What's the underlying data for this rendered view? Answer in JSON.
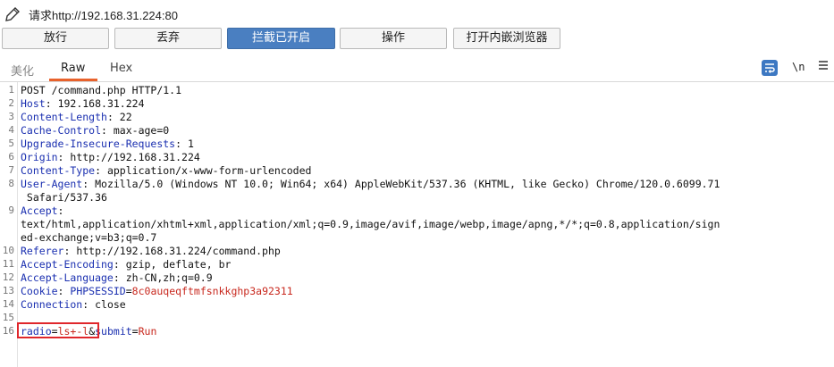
{
  "titlebar": {
    "icon": "pencil-icon",
    "title": "请求http://192.168.31.224:80"
  },
  "actions": {
    "forward": "放行",
    "drop": "丢弃",
    "intercept": "拦截已开启",
    "action": "操作",
    "open_browser": "打开内嵌浏览器"
  },
  "tabs": {
    "pretty": "美化",
    "raw": "Raw",
    "hex": "Hex"
  },
  "tools": {
    "wrap_icon": "wrap-lines-icon",
    "newline_label": "\\n",
    "menu_icon": "hamburger-menu-icon"
  },
  "colors": {
    "accent": "#4a7fc1",
    "tab_underline": "#e8622c",
    "highlight_box": "#e0262b",
    "header_name": "#1a2fb0",
    "value_red": "#c8281e"
  },
  "editor": {
    "line_numbers": [
      "1",
      "2",
      "3",
      "4",
      "5",
      "6",
      "7",
      "8",
      "",
      "9",
      "",
      "",
      "10",
      "11",
      "12",
      "13",
      "14",
      "15",
      "16"
    ],
    "request_line": "POST /command.php HTTP/1.1",
    "headers": [
      {
        "name": "Host",
        "value": " 192.168.31.224"
      },
      {
        "name": "Content-Length",
        "value": " 22"
      },
      {
        "name": "Cache-Control",
        "value": " max-age=0"
      },
      {
        "name": "Upgrade-Insecure-Requests",
        "value": " 1"
      },
      {
        "name": "Origin",
        "value": " http://192.168.31.224"
      },
      {
        "name": "Content-Type",
        "value": " application/x-www-form-urlencoded"
      },
      {
        "name": "User-Agent",
        "value": " Mozilla/5.0 (Windows NT 10.0; Win64; x64) AppleWebKit/537.36 (KHTML, like Gecko) Chrome/120.0.6099.71"
      },
      {
        "name": "",
        "value": " Safari/537.36"
      },
      {
        "name": "Accept",
        "value": ""
      },
      {
        "name": "",
        "value": "text/html,application/xhtml+xml,application/xml;q=0.9,image/avif,image/webp,image/apng,*/*;q=0.8,application/sign"
      },
      {
        "name": "",
        "value": "ed-exchange;v=b3;q=0.7"
      },
      {
        "name": "Referer",
        "value": " http://192.168.31.224/command.php"
      },
      {
        "name": "Accept-Encoding",
        "value": " gzip, deflate, br"
      },
      {
        "name": "Accept-Language",
        "value": " zh-CN,zh;q=0.9"
      },
      {
        "name": "Connection",
        "value": " close"
      }
    ],
    "cookie": {
      "name": "Cookie",
      "key": " PHPSESSID",
      "value": "8c0auqeqftmfsnkkghp3a92311"
    },
    "body": [
      {
        "param": "radio",
        "value": "ls+-l"
      },
      {
        "param": "submit",
        "value": "Run"
      }
    ]
  }
}
